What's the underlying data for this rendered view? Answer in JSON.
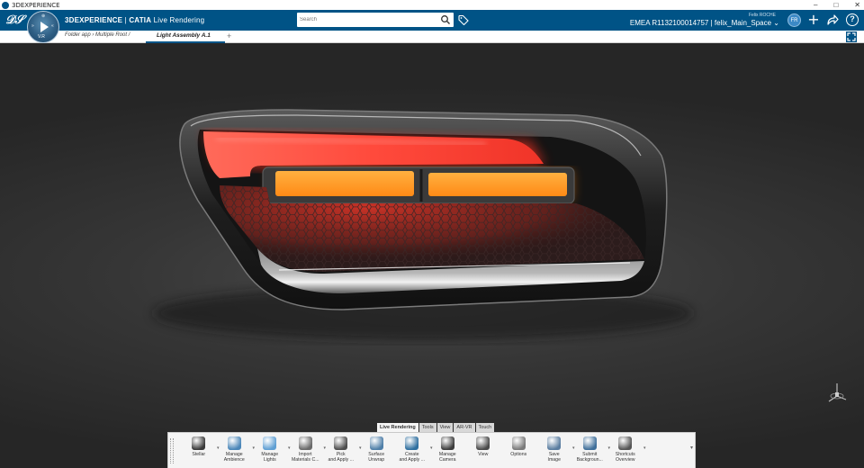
{
  "os_window": {
    "title": "3DEXPERIENCE",
    "minimize": "–",
    "maximize": "□",
    "close": "✕"
  },
  "top_bar": {
    "brand": "3DEXPERIENCE",
    "separator": " | ",
    "product": "CATIA",
    "app": "Live Rendering",
    "search_placeholder": "Search",
    "user_name": "Felix ROCHE",
    "tenant": "EMEA R1132100014757 | felix_Main_Space",
    "tenant_caret": "⌄",
    "avatar_initials": "FR",
    "accent_color": "#005386"
  },
  "compass": {
    "top": "⊕",
    "left": "»",
    "right": "«",
    "bottom": "V.R"
  },
  "tabs": {
    "crumb1": "Folder app",
    "crumb_sep": " › ",
    "crumb2": "Multiple Root",
    "crumb2_sep": " /",
    "active": "Light Assembly A.1",
    "add": "+"
  },
  "action_bar_tabs": [
    {
      "label": "Live Rendering",
      "active": true
    },
    {
      "label": "Tools",
      "active": false
    },
    {
      "label": "View",
      "active": false
    },
    {
      "label": "AR-VR",
      "active": false
    },
    {
      "label": "Touch",
      "active": false
    }
  ],
  "commands": [
    {
      "label": "Stellar",
      "icon": "clapperboard-icon",
      "color": "#3a3a3a",
      "caret": true
    },
    {
      "label": "Manage\nAmbience",
      "icon": "globe-ambience-icon",
      "color": "#4a86b8",
      "caret": true
    },
    {
      "label": "Manage\nLights",
      "icon": "lights-icon",
      "color": "#5f9fd3",
      "caret": true
    },
    {
      "label": "Import\nMaterials C...",
      "icon": "materials-icon",
      "color": "#6a6a6a",
      "caret": true
    },
    {
      "label": "Pick\nand Apply ...",
      "icon": "pick-material-icon",
      "color": "#4d4d4d",
      "caret": true
    },
    {
      "label": "Surface\nUnwrap",
      "icon": "surface-unwrap-icon",
      "color": "#4f7fa8",
      "caret": false
    },
    {
      "label": "Create\nand Apply ...",
      "icon": "create-material-icon",
      "color": "#2f6f9f",
      "caret": true
    },
    {
      "label": "Manage\nCamera",
      "icon": "camera-icon",
      "color": "#3d3d3d",
      "caret": false
    },
    {
      "label": "View",
      "icon": "view-icon",
      "color": "#4a4a4a",
      "caret": false
    },
    {
      "label": "Options",
      "icon": "options-gear-icon",
      "color": "#7a7a7a",
      "caret": false
    },
    {
      "label": "Save\nImage",
      "icon": "save-image-icon",
      "color": "#5a7da0",
      "caret": true
    },
    {
      "label": "Submit\nBackgroun...",
      "icon": "submit-background-icon",
      "color": "#3f6f9a",
      "caret": true
    },
    {
      "label": "Shortcuts\nOverview",
      "icon": "help-shortcuts-icon",
      "color": "#555555",
      "caret": true
    }
  ],
  "action_bar_more": "▾"
}
